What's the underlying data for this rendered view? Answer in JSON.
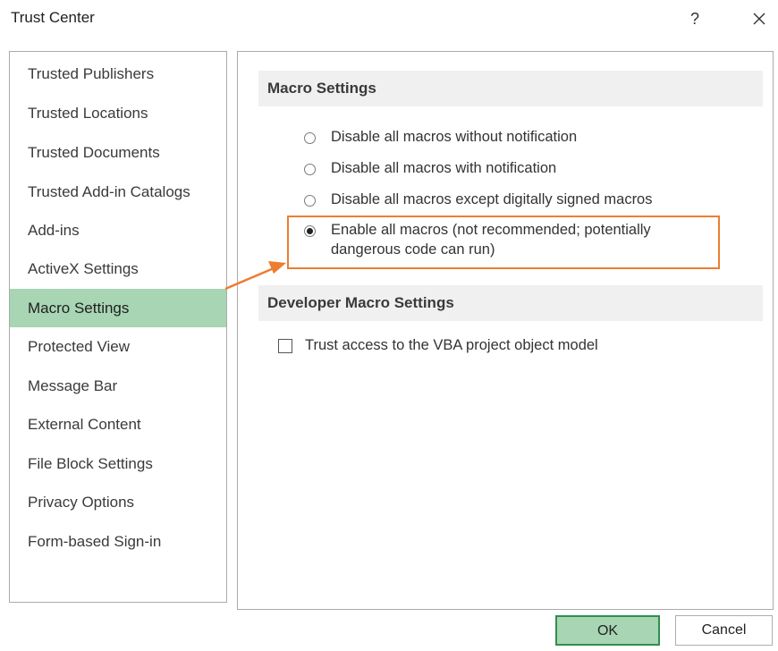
{
  "window": {
    "title": "Trust Center",
    "help_label": "?"
  },
  "sidebar": {
    "items": [
      {
        "label": "Trusted Publishers"
      },
      {
        "label": "Trusted Locations"
      },
      {
        "label": "Trusted Documents"
      },
      {
        "label": "Trusted Add-in Catalogs"
      },
      {
        "label": "Add-ins"
      },
      {
        "label": "ActiveX Settings"
      },
      {
        "label": "Macro Settings",
        "selected": true
      },
      {
        "label": "Protected View"
      },
      {
        "label": "Message Bar"
      },
      {
        "label": "External Content"
      },
      {
        "label": "File Block Settings"
      },
      {
        "label": "Privacy Options"
      },
      {
        "label": "Form-based Sign-in"
      }
    ]
  },
  "macro_settings": {
    "header": "Macro Settings",
    "options": [
      {
        "label": "Disable all macros without notification",
        "checked": false
      },
      {
        "label": "Disable all macros with notification",
        "checked": false
      },
      {
        "label": "Disable all macros except digitally signed macros",
        "checked": false
      },
      {
        "label": "Enable all macros (not recommended; potentially dangerous code can run)",
        "checked": true
      }
    ]
  },
  "developer_settings": {
    "header": "Developer Macro Settings",
    "vba_access_label": "Trust access to the VBA project object model",
    "vba_access_checked": false
  },
  "buttons": {
    "ok": "OK",
    "cancel": "Cancel"
  },
  "colors": {
    "selection": "#a8d5b4",
    "highlight": "#ed7d31",
    "ok_border": "#2f8f4e"
  }
}
